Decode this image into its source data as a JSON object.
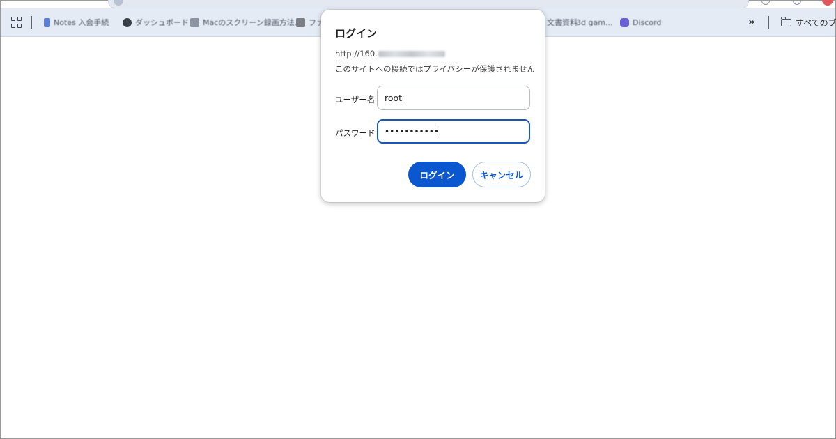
{
  "browser": {
    "bookmarks_bar": {
      "bookmarks": [
        {
          "label": "Notes 入会手続",
          "icon": "bookmark-blue-icon",
          "icon_color": "#5b7fd6"
        },
        {
          "label": "ダッシュボード",
          "icon": "gear-icon",
          "icon_color": "#3b3f47"
        },
        {
          "label": "Macのスクリーン録画方法...",
          "icon": "image-icon",
          "icon_color": "#8c93a1"
        },
        {
          "label": "ファイル",
          "icon": "folder-icon",
          "icon_color": "#7d7f86"
        },
        {
          "label": "文書資料",
          "icon": "document-icon",
          "icon_color": "#8c93a1"
        },
        {
          "label": "3d gam...",
          "icon": "link-icon",
          "icon_color": "#8c93a1"
        },
        {
          "label": "Discord",
          "icon": "discord-icon",
          "icon_color": "#6b5fd8"
        }
      ],
      "overflow_chevron": "»",
      "all_bookmarks_label": "すべてのブ"
    }
  },
  "dialog": {
    "title": "ログイン",
    "url_prefix": "http://160.",
    "warning": "このサイトへの接続ではプライバシーが保護されません",
    "username_label": "ユーザー名",
    "username_value": "root",
    "password_label": "パスワード",
    "password_value": "•••••••••••",
    "login_button": "ログイン",
    "cancel_button": "キャンセル"
  },
  "colors": {
    "primary": "#0b57d0",
    "focus_border": "#1a56b8",
    "toolbar_bg": "#e4ebf4"
  }
}
